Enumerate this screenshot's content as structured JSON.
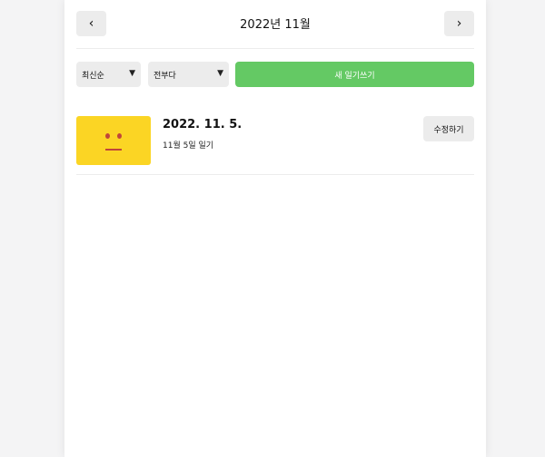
{
  "header": {
    "title": "2022년 11월",
    "prev_label": "‹",
    "next_label": "›"
  },
  "controls": {
    "sort_selected": "최신순",
    "filter_selected": "전부다",
    "new_button_label": "새 일기쓰기"
  },
  "diary_list": [
    {
      "date": "2022. 11. 5.",
      "content": "11월 5일 일기",
      "edit_label": "수정하기",
      "emotion_color": "#fbd524"
    }
  ],
  "colors": {
    "accent_green": "#64c964",
    "button_gray": "#ececec",
    "emotion_yellow": "#fbd524",
    "face_red": "#c0463a"
  }
}
